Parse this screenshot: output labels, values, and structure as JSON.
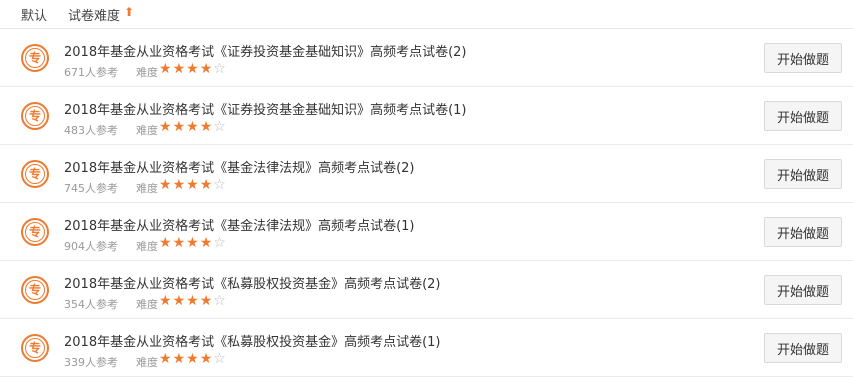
{
  "sort_bar": {
    "default_label": "默认",
    "difficulty_label": "试卷难度",
    "arrow_glyph": "⬆",
    "accent_color": "#f07a2f"
  },
  "badge_text": "专",
  "difficulty_label": "难度",
  "start_button_label": "开始做题",
  "items": [
    {
      "title": "2018年基金从业资格考试《证券投资基金基础知识》高频考点试卷(2)",
      "participants": "671人参考",
      "stars": 4
    },
    {
      "title": "2018年基金从业资格考试《证券投资基金基础知识》高频考点试卷(1)",
      "participants": "483人参考",
      "stars": 4
    },
    {
      "title": "2018年基金从业资格考试《基金法律法规》高频考点试卷(2)",
      "participants": "745人参考",
      "stars": 4
    },
    {
      "title": "2018年基金从业资格考试《基金法律法规》高频考点试卷(1)",
      "participants": "904人参考",
      "stars": 4
    },
    {
      "title": "2018年基金从业资格考试《私募股权投资基金》高频考点试卷(2)",
      "participants": "354人参考",
      "stars": 4
    },
    {
      "title": "2018年基金从业资格考试《私募股权投资基金》高频考点试卷(1)",
      "participants": "339人参考",
      "stars": 4
    }
  ],
  "max_stars": 5
}
